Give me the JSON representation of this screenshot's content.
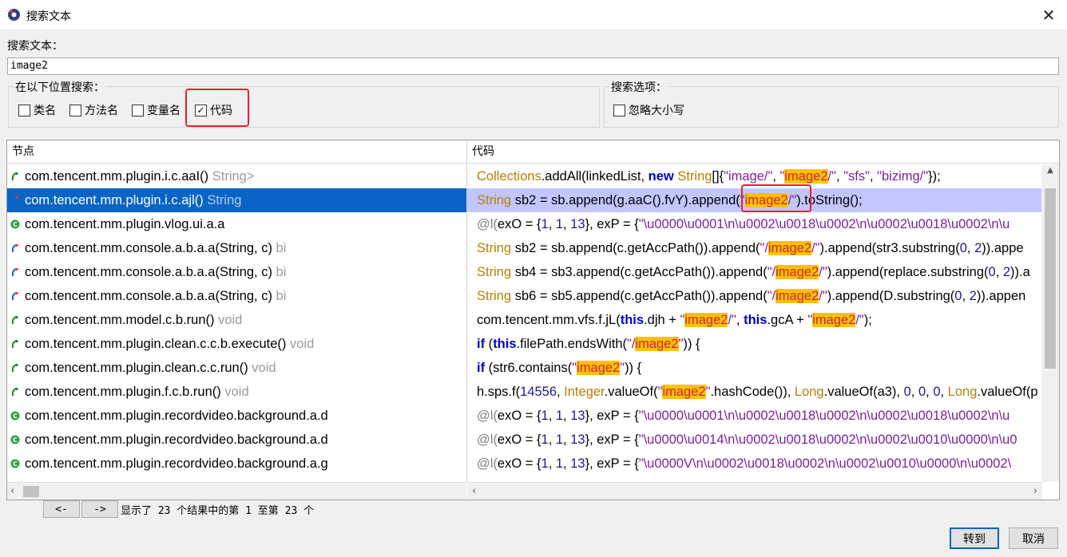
{
  "window": {
    "title": "搜索文本",
    "close_glyph": "✕"
  },
  "search": {
    "label": "搜索文本：",
    "value": "image2"
  },
  "location_group": {
    "title": "在以下位置搜索：",
    "options": [
      {
        "label": "类名",
        "checked": false
      },
      {
        "label": "方法名",
        "checked": false
      },
      {
        "label": "变量名",
        "checked": false
      },
      {
        "label": "代码",
        "checked": true
      }
    ]
  },
  "options_group": {
    "title": "搜索选项：",
    "options": [
      {
        "label": "忽略大小写",
        "checked": false
      }
    ]
  },
  "table": {
    "headers": {
      "node": "节点",
      "code": "代码"
    },
    "rows": [
      {
        "icon": "method-icon",
        "node": "com.tencent.mm.plugin.i.c.aaI()",
        "type": " String>",
        "code": [
          [
            "Collections",
            "class"
          ],
          [
            ".addAll(linkedList, ",
            "plain"
          ],
          [
            "new",
            "kw"
          ],
          [
            " ",
            "plain"
          ],
          [
            "String",
            "class"
          ],
          [
            "[]{",
            "plain"
          ],
          [
            "\"image/\"",
            "str"
          ],
          [
            ", ",
            "plain"
          ],
          [
            "\"",
            "str"
          ],
          [
            "image2",
            "hit"
          ],
          [
            "/\"",
            "str"
          ],
          [
            ", ",
            "plain"
          ],
          [
            "\"sfs\"",
            "str"
          ],
          [
            ", ",
            "plain"
          ],
          [
            "\"bizimg/\"",
            "str"
          ],
          [
            "});",
            "plain"
          ]
        ]
      },
      {
        "icon": "static-method-icon",
        "node": "com.tencent.mm.plugin.i.c.ajl()",
        "type": " String",
        "selected": true,
        "code": [
          [
            "String",
            "class"
          ],
          [
            " sb2 = sb.append(g.aaC().fvY).append(",
            "plain"
          ],
          [
            "\"",
            "str"
          ],
          [
            "image2",
            "hit"
          ],
          [
            "/\"",
            "str"
          ],
          [
            ").toString();",
            "plain"
          ]
        ]
      },
      {
        "icon": "class-icon",
        "node": "com.tencent.mm.plugin.vlog.ui.a.a",
        "type": "",
        "code": [
          [
            "@l(",
            "annot"
          ],
          [
            "exO = {",
            "plain"
          ],
          [
            "1",
            "num"
          ],
          [
            ", ",
            "plain"
          ],
          [
            "1",
            "num"
          ],
          [
            ", ",
            "plain"
          ],
          [
            "13",
            "num"
          ],
          [
            "}, exP = {",
            "plain"
          ],
          [
            "\"\\u0000\u0001\\u0001\\n\\u0002\\u0018\\u0002\\n\\u0002\\u0018\\u0002\\n\\u",
            "str"
          ]
        ]
      },
      {
        "icon": "static-method-icon",
        "node": "com.tencent.mm.console.a.b.a.a(String, c)",
        "type": " bi",
        "code": [
          [
            "String",
            "class"
          ],
          [
            " sb2 = sb.append(c.getAccPath()).append(",
            "plain"
          ],
          [
            "\"/",
            "str"
          ],
          [
            "image2",
            "hit"
          ],
          [
            "/\"",
            "str"
          ],
          [
            ").append(str3.substring(",
            "plain"
          ],
          [
            "0",
            "num"
          ],
          [
            ", ",
            "plain"
          ],
          [
            "2",
            "num"
          ],
          [
            ")).appe",
            "plain"
          ]
        ]
      },
      {
        "icon": "static-method-icon",
        "node": "com.tencent.mm.console.a.b.a.a(String, c)",
        "type": " bi",
        "code": [
          [
            "String",
            "class"
          ],
          [
            " sb4 = sb3.append(c.getAccPath()).append(",
            "plain"
          ],
          [
            "\"/",
            "str"
          ],
          [
            "image2",
            "hit"
          ],
          [
            "/\"",
            "str"
          ],
          [
            ").append(replace.substring(",
            "plain"
          ],
          [
            "0",
            "num"
          ],
          [
            ", ",
            "plain"
          ],
          [
            "2",
            "num"
          ],
          [
            ")).a",
            "plain"
          ]
        ]
      },
      {
        "icon": "static-method-icon",
        "node": "com.tencent.mm.console.a.b.a.a(String, c)",
        "type": " bi",
        "code": [
          [
            "String",
            "class"
          ],
          [
            " sb6 = sb5.append(c.getAccPath()).append(",
            "plain"
          ],
          [
            "\"/",
            "str"
          ],
          [
            "image2",
            "hit"
          ],
          [
            "/\"",
            "str"
          ],
          [
            ").append(D.substring(",
            "plain"
          ],
          [
            "0",
            "num"
          ],
          [
            ", ",
            "plain"
          ],
          [
            "2",
            "num"
          ],
          [
            ")).appen",
            "plain"
          ]
        ]
      },
      {
        "icon": "method-icon",
        "node": "com.tencent.mm.model.c.b.run()",
        "type": " void",
        "code": [
          [
            "com.tencent.mm.vfs.f.jL(",
            "plain"
          ],
          [
            "this",
            "kw"
          ],
          [
            ".djh + ",
            "plain"
          ],
          [
            "\"",
            "str"
          ],
          [
            "image2",
            "hit"
          ],
          [
            "/\"",
            "str"
          ],
          [
            ", ",
            "plain"
          ],
          [
            "this",
            "kw"
          ],
          [
            ".gcA + ",
            "plain"
          ],
          [
            "\"",
            "str"
          ],
          [
            "image2",
            "hit"
          ],
          [
            "/\"",
            "str"
          ],
          [
            ");",
            "plain"
          ]
        ]
      },
      {
        "icon": "method-icon",
        "node": "com.tencent.mm.plugin.clean.c.c.b.execute()",
        "type": " void",
        "code": [
          [
            "if",
            "kw"
          ],
          [
            " (",
            "plain"
          ],
          [
            "this",
            "kw"
          ],
          [
            ".filePath.endsWith(",
            "plain"
          ],
          [
            "\"/",
            "str"
          ],
          [
            "image2",
            "hit"
          ],
          [
            "\"",
            "str"
          ],
          [
            ")) {",
            "plain"
          ]
        ]
      },
      {
        "icon": "method-icon",
        "node": "com.tencent.mm.plugin.clean.c.c.run()",
        "type": " void",
        "code": [
          [
            "if",
            "kw"
          ],
          [
            " (str6.contains(",
            "plain"
          ],
          [
            "\"",
            "str"
          ],
          [
            "image2",
            "hit"
          ],
          [
            "\"",
            "str"
          ],
          [
            ")) {",
            "plain"
          ]
        ]
      },
      {
        "icon": "method-icon",
        "node": "com.tencent.mm.plugin.f.c.b.run()",
        "type": " void",
        "code": [
          [
            "h.sps.f(",
            "plain"
          ],
          [
            "14556",
            "num"
          ],
          [
            ", ",
            "plain"
          ],
          [
            "Integer",
            "class"
          ],
          [
            ".valueOf(",
            "plain"
          ],
          [
            "\"",
            "str"
          ],
          [
            "image2",
            "hit"
          ],
          [
            "\"",
            "str"
          ],
          [
            ".hashCode()), ",
            "plain"
          ],
          [
            "Long",
            "class"
          ],
          [
            ".valueOf(a3), ",
            "plain"
          ],
          [
            "0",
            "num"
          ],
          [
            ", ",
            "plain"
          ],
          [
            "0",
            "num"
          ],
          [
            ", ",
            "plain"
          ],
          [
            "0",
            "num"
          ],
          [
            ", ",
            "plain"
          ],
          [
            "Long",
            "class"
          ],
          [
            ".valueOf(p",
            "plain"
          ]
        ]
      },
      {
        "icon": "class-icon",
        "node": "com.tencent.mm.plugin.recordvideo.background.a.d",
        "type": "",
        "code": [
          [
            "@l(",
            "annot"
          ],
          [
            "exO = {",
            "plain"
          ],
          [
            "1",
            "num"
          ],
          [
            ", ",
            "plain"
          ],
          [
            "1",
            "num"
          ],
          [
            ", ",
            "plain"
          ],
          [
            "13",
            "num"
          ],
          [
            "}, exP = {",
            "plain"
          ],
          [
            "\"\\u0000\u0001\\u0001\\n\\u0002\\u0018\\u0002\\n\\u0002\\u0018\\u0002\\n\\u",
            "str"
          ]
        ]
      },
      {
        "icon": "class-icon",
        "node": "com.tencent.mm.plugin.recordvideo.background.a.d",
        "type": "",
        "code": [
          [
            "@l(",
            "annot"
          ],
          [
            "exO = {",
            "plain"
          ],
          [
            "1",
            "num"
          ],
          [
            ", ",
            "plain"
          ],
          [
            "1",
            "num"
          ],
          [
            ", ",
            "plain"
          ],
          [
            "13",
            "num"
          ],
          [
            "}, exP = {",
            "plain"
          ],
          [
            "\"\\u0000\\u0014\\n\\u0002\\u0018\\u0002\\n\\u0002\\u0010\\u0000\\n\\u0",
            "str"
          ]
        ]
      },
      {
        "icon": "class-icon",
        "node": "com.tencent.mm.plugin.recordvideo.background.a.g",
        "type": "",
        "code": [
          [
            "@l(",
            "annot"
          ],
          [
            "exO = {",
            "plain"
          ],
          [
            "1",
            "num"
          ],
          [
            ", ",
            "plain"
          ],
          [
            "1",
            "num"
          ],
          [
            ", ",
            "plain"
          ],
          [
            "13",
            "num"
          ],
          [
            "}, exP = {",
            "plain"
          ],
          [
            "\"\\u0000V\\n\\u0002\\u0018\\u0002\\n\\u0002\\u0010\\u0000\\n\\u0002\\",
            "str"
          ]
        ]
      }
    ]
  },
  "pager": {
    "prev": "<-",
    "next": "->",
    "status": "显示了 23 个结果中的第 1 至第 23 个"
  },
  "buttons": {
    "goto": "转到",
    "cancel": "取消"
  },
  "colors": {
    "selection": "#0a64c8",
    "code_selection": "#c2c6ff",
    "hit_bg": "#ffc107",
    "hit_fg": "#c62828",
    "annotation_box": "#e8202a"
  }
}
